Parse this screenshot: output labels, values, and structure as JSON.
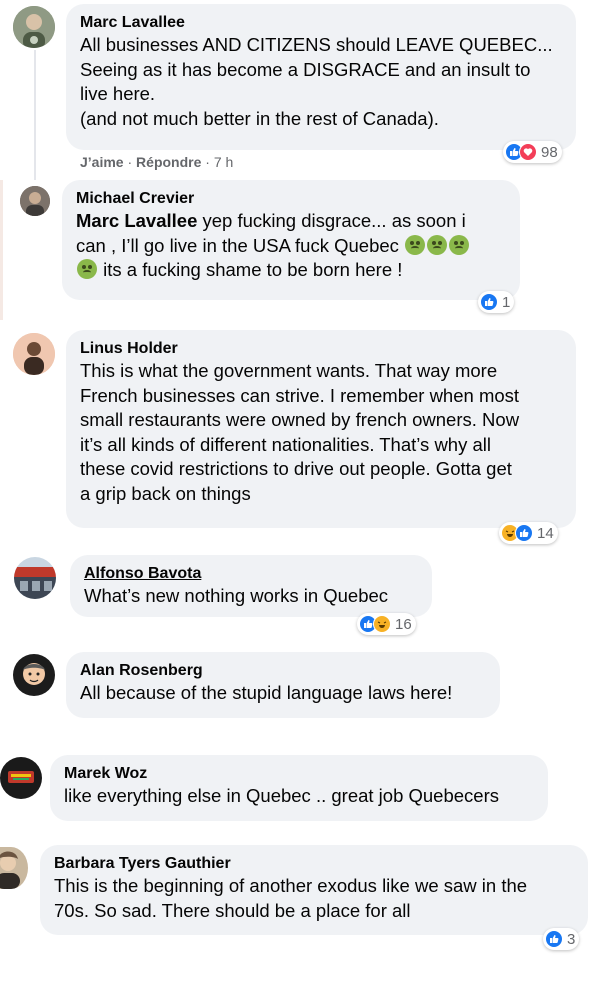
{
  "comments": [
    {
      "author": "Marc Lavallee",
      "lines": [
        "All businesses AND CITIZENS should LEAVE QUEBEC...",
        "Seeing as it has become a DISGRACE and an insult to",
        "live here.",
        "(and not much better in the rest of Canada)."
      ],
      "actions": {
        "like": "J’aime",
        "sep1": " · ",
        "reply": "Répondre",
        "sep2": " · ",
        "time": "7 h"
      },
      "reactions": [
        "like",
        "love"
      ],
      "count": "98"
    },
    {
      "author": "Michael Crevier",
      "mention": "Marc Lavallee",
      "line1_rest": " yep fucking disgrace... as soon i",
      "line2": "can , I’ll go live in the USA fuck Quebec ",
      "line3": " its a fucking shame to be born here !",
      "reactions": [
        "like"
      ],
      "count": "1"
    },
    {
      "author": "Linus Holder",
      "lines": [
        "This is what the government wants. That way more",
        "French businesses can strive. I remember when most",
        "small restaurants were owned by french owners. Now",
        "it’s all kinds of different nationalities. That’s why all",
        "these covid restrictions to drive out people. Gotta get",
        "a grip back on things"
      ],
      "reactions": [
        "haha",
        "like"
      ],
      "count": "14"
    },
    {
      "author": "Alfonso Bavota",
      "lines": [
        "What’s new nothing works in Quebec"
      ],
      "reactions": [
        "like",
        "haha"
      ],
      "count": "16"
    },
    {
      "author": "Alan Rosenberg",
      "lines": [
        "All because of the stupid language laws here!"
      ]
    },
    {
      "author": "Marek Woz",
      "lines": [
        "like everything else in Quebec .. great job Quebecers"
      ]
    },
    {
      "author": "Barbara Tyers Gauthier",
      "lines": [
        "This is the beginning of another exodus like we saw in the",
        "70s. So sad. There should be a place for all"
      ],
      "reactions": [
        "like"
      ],
      "count": "3"
    }
  ],
  "colors": {
    "bubble": "#f0f2f5",
    "like": "#1877f2",
    "love": "#f33e58",
    "haha": "#f7b125",
    "meta": "#65676b"
  },
  "icons": [
    "like-reaction-icon",
    "love-reaction-icon",
    "haha-reaction-icon",
    "sick-emoji-icon"
  ]
}
